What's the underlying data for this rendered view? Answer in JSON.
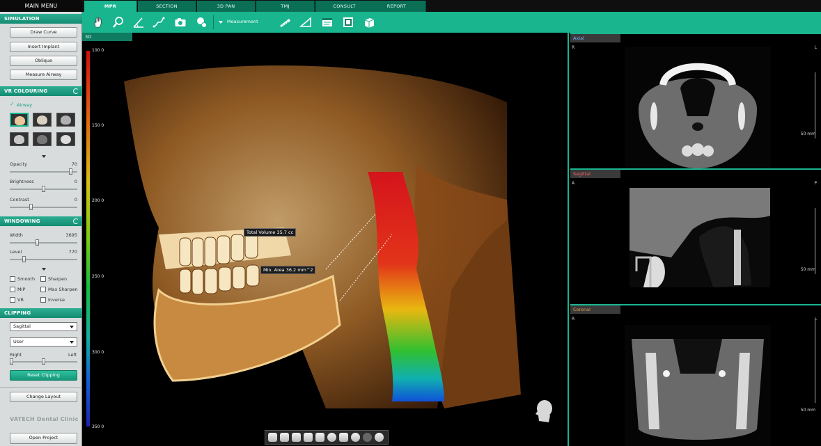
{
  "main_menu": {
    "title": "MAIN MENU"
  },
  "simulation": {
    "title": "SIMULATION",
    "buttons": [
      "Draw Curve",
      "Insert Implant",
      "Oblique",
      "Measure Airway"
    ]
  },
  "vr_colouring": {
    "title": "VR COLOURING",
    "mode_label": "Airway",
    "opacity_label": "Opacity",
    "opacity_value": "70",
    "opacity_fraction": 0.92,
    "brightness_label": "Brightness",
    "brightness_value": "0",
    "brightness_fraction": 0.5,
    "contrast_label": "Contrast",
    "contrast_value": "0",
    "contrast_fraction": 0.3
  },
  "windowing": {
    "title": "WINDOWING",
    "width_label": "Width",
    "width_value": "3695",
    "width_fraction": 0.4,
    "level_label": "Level",
    "level_value": "770",
    "level_fraction": 0.2,
    "options": [
      "Smooth",
      "Sharpen",
      "MIP",
      "Max Sharpen",
      "VR",
      "Inverse"
    ]
  },
  "clipping": {
    "title": "CLIPPING",
    "plane_value": "Sagittal",
    "mode_value": "User",
    "right_label": "Right",
    "left_label": "Left",
    "reset_label": "Reset Clipping"
  },
  "change_layout_label": "Change Layout",
  "brand": "VATECH Dental Clinic",
  "open_project_label": "Open Project",
  "tabs": [
    "MPR",
    "SECTION",
    "3D PAN",
    "TMJ",
    "CONSULT",
    "REPORT"
  ],
  "active_tab": "MPR",
  "toolbar": {
    "measurement_label": "Measurement",
    "icons": [
      "hand-icon",
      "zoom-icon",
      "angle-icon",
      "curve-icon",
      "camera-icon",
      "reset-view-icon",
      "dropdown-icon",
      "ruler-icon",
      "angle-measure-icon",
      "note-icon",
      "capture-icon",
      "export-icon"
    ]
  },
  "view3d": {
    "label": "3D",
    "colorbar_ticks": [
      "100 0",
      "150 0",
      "200 0",
      "250 0",
      "300 0",
      "350 0"
    ],
    "annotations": {
      "volume": "Total Volume 35.7 cc",
      "min_area": "Min. Area 36.2 mm^2"
    },
    "bottom_tool_count": 10
  },
  "panes": [
    {
      "name": "Axial",
      "color": "#7fb0ff",
      "left": "R",
      "right": "L",
      "scale": "50 mm"
    },
    {
      "name": "Sagittal",
      "color": "#ff6666",
      "left": "A",
      "right": "P",
      "scale": "50 mm"
    },
    {
      "name": "Coronal",
      "color": "#e6a04a",
      "left": "R",
      "right": "L",
      "scale": "50 mm"
    }
  ],
  "colors": {
    "accent": "#19b58f",
    "section_header": "#148c74"
  }
}
